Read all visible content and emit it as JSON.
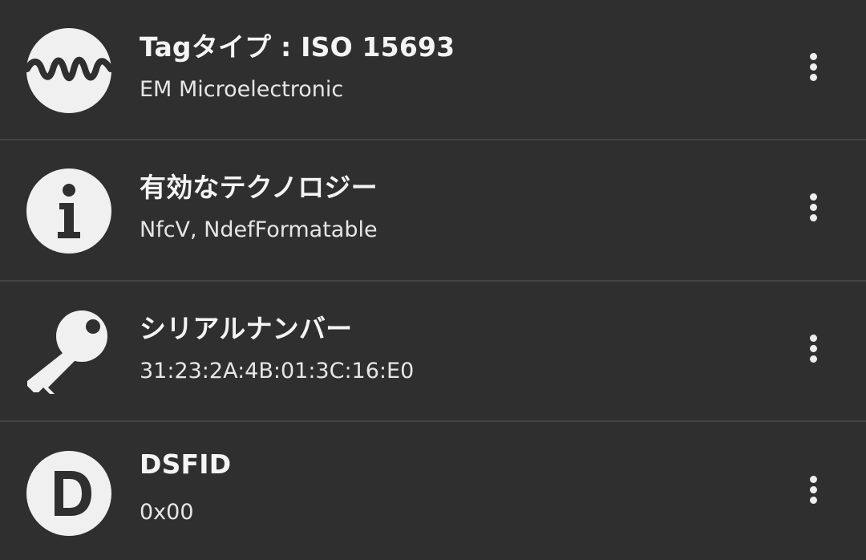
{
  "rows": [
    {
      "icon": "waveform-icon",
      "title": "Tagタイプ : ISO 15693",
      "subtitle": "EM Microelectronic",
      "menu": "more-vert-icon"
    },
    {
      "icon": "info-icon",
      "title": "有効なテクノロジー",
      "subtitle": "NfcV, NdefFormatable",
      "menu": "more-vert-icon"
    },
    {
      "icon": "key-icon",
      "title": "シリアルナンバー",
      "subtitle": "31:23:2A:4B:01:3C:16:E0",
      "menu": "more-vert-icon"
    },
    {
      "icon": "letter-d-icon",
      "title": "DSFID",
      "subtitle": "0x00",
      "menu": "more-vert-icon"
    }
  ],
  "colors": {
    "background": "#2f2f2f",
    "divider": "#444444",
    "icon": "#f0f0f0",
    "text": "#f4f4f4"
  }
}
